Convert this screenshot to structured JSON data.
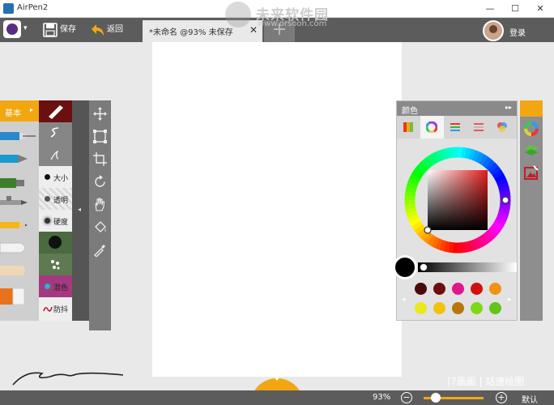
{
  "window": {
    "title": "AirPen2",
    "controls": [
      "minimize",
      "maximize",
      "close"
    ]
  },
  "watermark": {
    "site_name": "未来软件园",
    "url": "www.orsoon.com"
  },
  "toolbar": {
    "save_label": "保存",
    "back_label": "返回",
    "tab_label": "*未命名 @93% 未保存",
    "tab_close": "✕",
    "tab_add": "+",
    "login_label": "登录"
  },
  "left_panel": {
    "category_label": "基本",
    "category_arrow": "▸",
    "tools": [
      "fountain-pen",
      "calligraphy-pen",
      "marker",
      "airbrush",
      "pencil",
      "chalk",
      "crayon",
      "eraser"
    ],
    "brush_settings": [
      {
        "label": "大小"
      },
      {
        "label": "透明"
      },
      {
        "label": "硬度"
      },
      {
        "label": "混色"
      },
      {
        "label": "防抖"
      }
    ],
    "collapse_arrow": "◂"
  },
  "tool_strip": [
    "move",
    "transform",
    "crop",
    "rotate",
    "hand",
    "fill-bucket",
    "eyedropper"
  ],
  "color_panel": {
    "title": "颜色",
    "expand_icon": "▸▸",
    "tabs": [
      "palette-cubes",
      "color-wheel",
      "sliders-rgb",
      "sliders-hsv",
      "color-mix"
    ],
    "selected_tab": 1,
    "current_color": "#000000",
    "swatches_row1": [
      "#4a0a0a",
      "#6e0d0d",
      "#e0168c",
      "#d40e0e",
      "#f29112"
    ],
    "swatches_row2": [
      "#e9e91c",
      "#f0c20c",
      "#b8760c",
      "#7ed817",
      "#62c41c"
    ],
    "prev_arrow": "◂",
    "next_arrow": "▸"
  },
  "colors": {
    "accent": "#f2a712",
    "toolbar_bg": "#5c5c5c"
  },
  "footer": {
    "brand_text": "|7画画 | 站速绘图",
    "zoom": "93%",
    "zoom_out": "−",
    "zoom_in": "+",
    "zoom_level": 0.2,
    "default_label": "默认"
  }
}
